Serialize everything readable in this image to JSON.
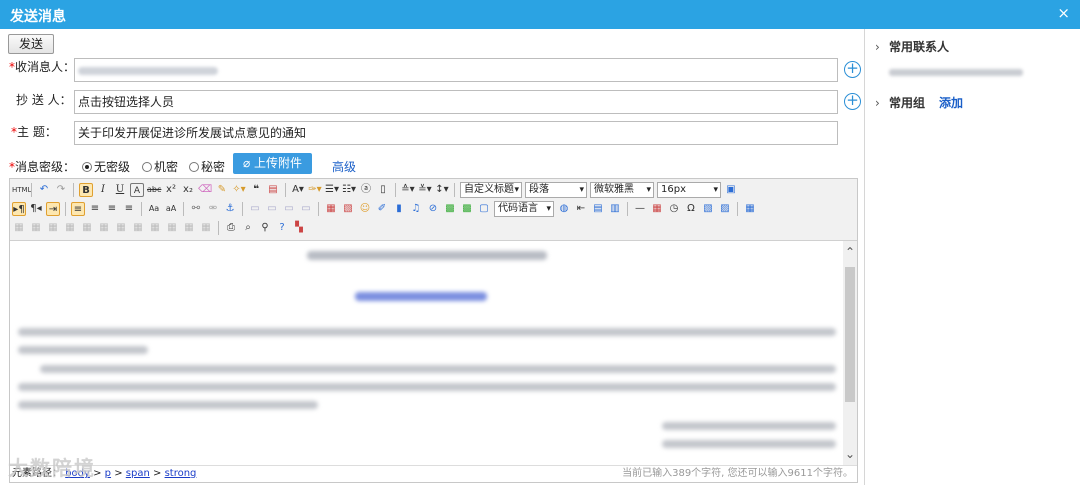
{
  "window": {
    "title": "发送消息",
    "close_label": "×"
  },
  "form": {
    "send_label": "发送",
    "recipient": {
      "required_mark": "*",
      "label": "收消息人：",
      "value": ""
    },
    "cc": {
      "label": "抄  送 人：",
      "placeholder": "点击按钮选择人员"
    },
    "subject": {
      "required_mark": "*",
      "label": "主    题：",
      "value": "关于印发开展促进诊所发展试点意见的通知"
    },
    "security": {
      "required_mark": "*",
      "label": "消息密级：",
      "options": [
        "无密级",
        "机密",
        "秘密"
      ],
      "selected": "无密级"
    },
    "upload_label": "上传附件",
    "advanced_label": "高级",
    "add_icon": "plus-circle-icon"
  },
  "editor": {
    "toolbar": {
      "format_select": "自定义标题",
      "paragraph_select": "段落",
      "font_select": "微软雅黑",
      "size_select": "16px",
      "code_select": "代码语言"
    },
    "statusbar": {
      "path_label": "元素路径：",
      "path": [
        "body",
        "p",
        "span",
        "strong"
      ],
      "count_text": "当前已输入389个字符, 您还可以输入9611个字符。"
    }
  },
  "sidebar": {
    "contacts_label": "常用联系人",
    "groups_label": "常用组",
    "add_label": "添加"
  },
  "watermark": {
    "text": "大数陪境"
  },
  "colors": {
    "titlebar": "#2ba3e3",
    "link": "#1a5fc8",
    "required": "#e00000"
  }
}
